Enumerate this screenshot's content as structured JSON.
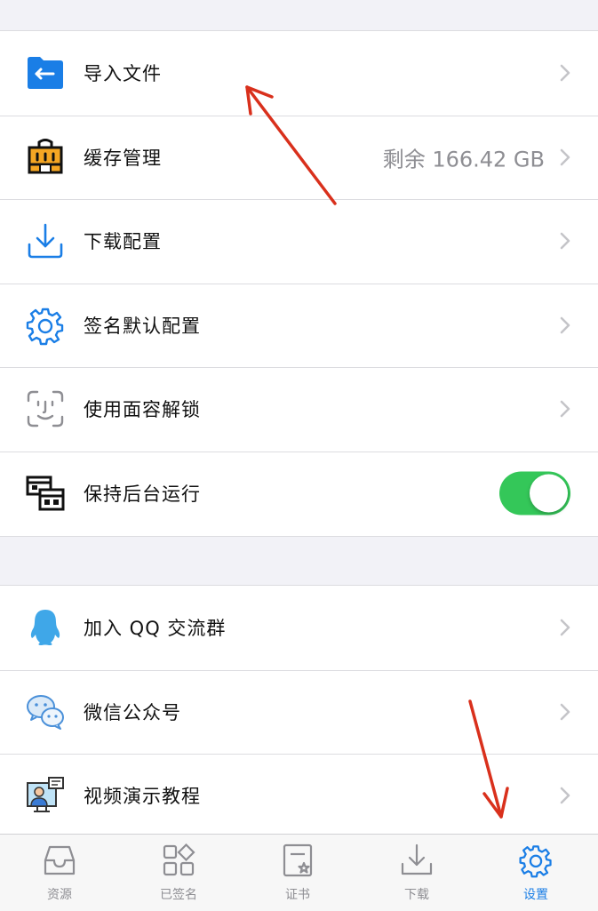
{
  "settings_group": {
    "import_files": {
      "label": "导入文件",
      "icon": "folder-import-icon"
    },
    "cache": {
      "label": "缓存管理",
      "value": "剩余 166.42 GB",
      "icon": "cache-building-icon"
    },
    "download_config": {
      "label": "下载配置",
      "icon": "download-tray-icon"
    },
    "signing_default": {
      "label": "签名默认配置",
      "icon": "gear-icon"
    },
    "face_id": {
      "label": "使用面容解锁",
      "icon": "face-id-icon"
    },
    "background": {
      "label": "保持后台运行",
      "toggle_on": true,
      "icon": "background-windows-icon"
    }
  },
  "community_group": {
    "qq_group": {
      "label": "加入 QQ 交流群",
      "icon": "qq-penguin-icon"
    },
    "wechat": {
      "label": "微信公众号",
      "icon": "wechat-bubbles-icon"
    },
    "video_tutorial": {
      "label": "视频演示教程",
      "icon": "video-presenter-icon"
    }
  },
  "tabbar": {
    "resources": "资源",
    "signed": "已签名",
    "certificate": "证书",
    "download": "下载",
    "settings": "设置",
    "active": "settings"
  },
  "colors": {
    "accent": "#1a7ee6",
    "toggle_on": "#34c759",
    "annotation_arrow": "#d9301c",
    "secondary_text": "#8e8e93"
  }
}
